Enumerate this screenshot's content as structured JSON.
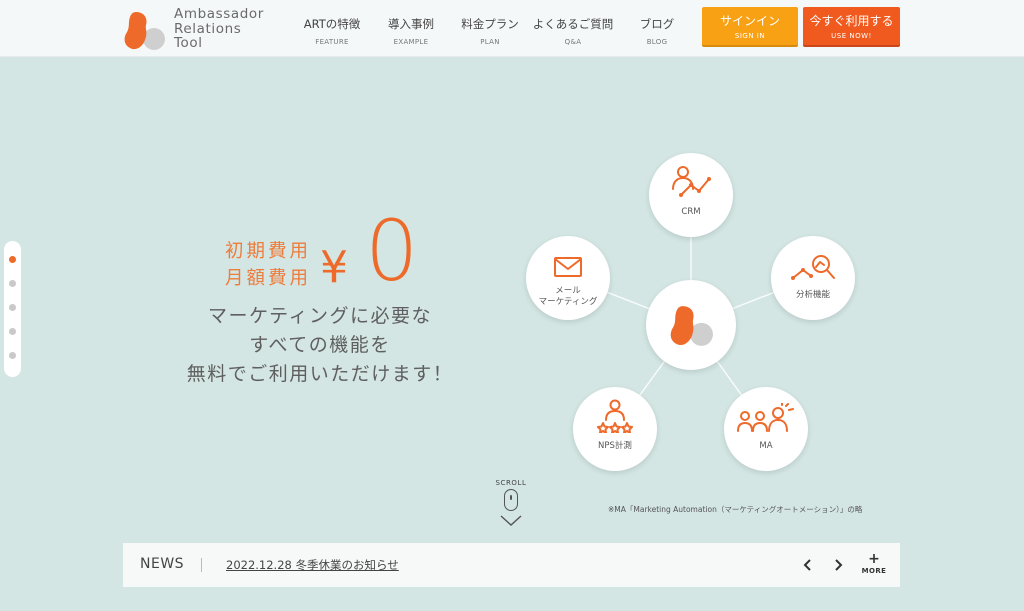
{
  "brand": {
    "name_lines": [
      "Ambassador",
      "Relations",
      "Tool"
    ],
    "colors": {
      "orange": "#ee6a2a",
      "light_orange": "#f9a114",
      "cta": "#f15a1e",
      "bg": "#d3e6e4",
      "gray": "#cfcfcf"
    }
  },
  "nav": [
    {
      "jp": "ARTの特徴",
      "en": "FEATURE"
    },
    {
      "jp": "導入事例",
      "en": "EXAMPLE"
    },
    {
      "jp": "料金プラン",
      "en": "PLAN"
    },
    {
      "jp": "よくあるご質問",
      "en": "Q&A"
    },
    {
      "jp": "ブログ",
      "en": "BLOG"
    }
  ],
  "buttons": {
    "signin": {
      "jp": "サインイン",
      "en": "SIGN IN"
    },
    "use_now": {
      "jp": "今すぐ利用する",
      "en": "USE NOW!"
    }
  },
  "slider": {
    "count": 5,
    "active": 0
  },
  "hero": {
    "fee_line1": "初期費用",
    "fee_line2": "月額費用",
    "yen": "¥",
    "zero": "0",
    "line1": "マーケティングに必要な",
    "line2": "すべての機能を",
    "line3": "無料でご利用いただけます！"
  },
  "features": {
    "crm": "CRM",
    "analytics": "分析機能",
    "mail_line1": "メール",
    "mail_line2": "マーケティング",
    "nps": "NPS計測",
    "ma": "MA",
    "icons": [
      "crm-person-chart-icon",
      "analytics-magnifier-icon",
      "mail-envelope-icon",
      "nps-person-stars-icon",
      "ma-people-group-icon"
    ]
  },
  "footnote": "※MA「Marketing Automation（マーケティングオートメーション）」の略",
  "scroll": {
    "label": "SCROLL"
  },
  "news": {
    "title": "NEWS",
    "item": "2022.12.28 冬季休業のお知らせ",
    "more": "MORE"
  }
}
